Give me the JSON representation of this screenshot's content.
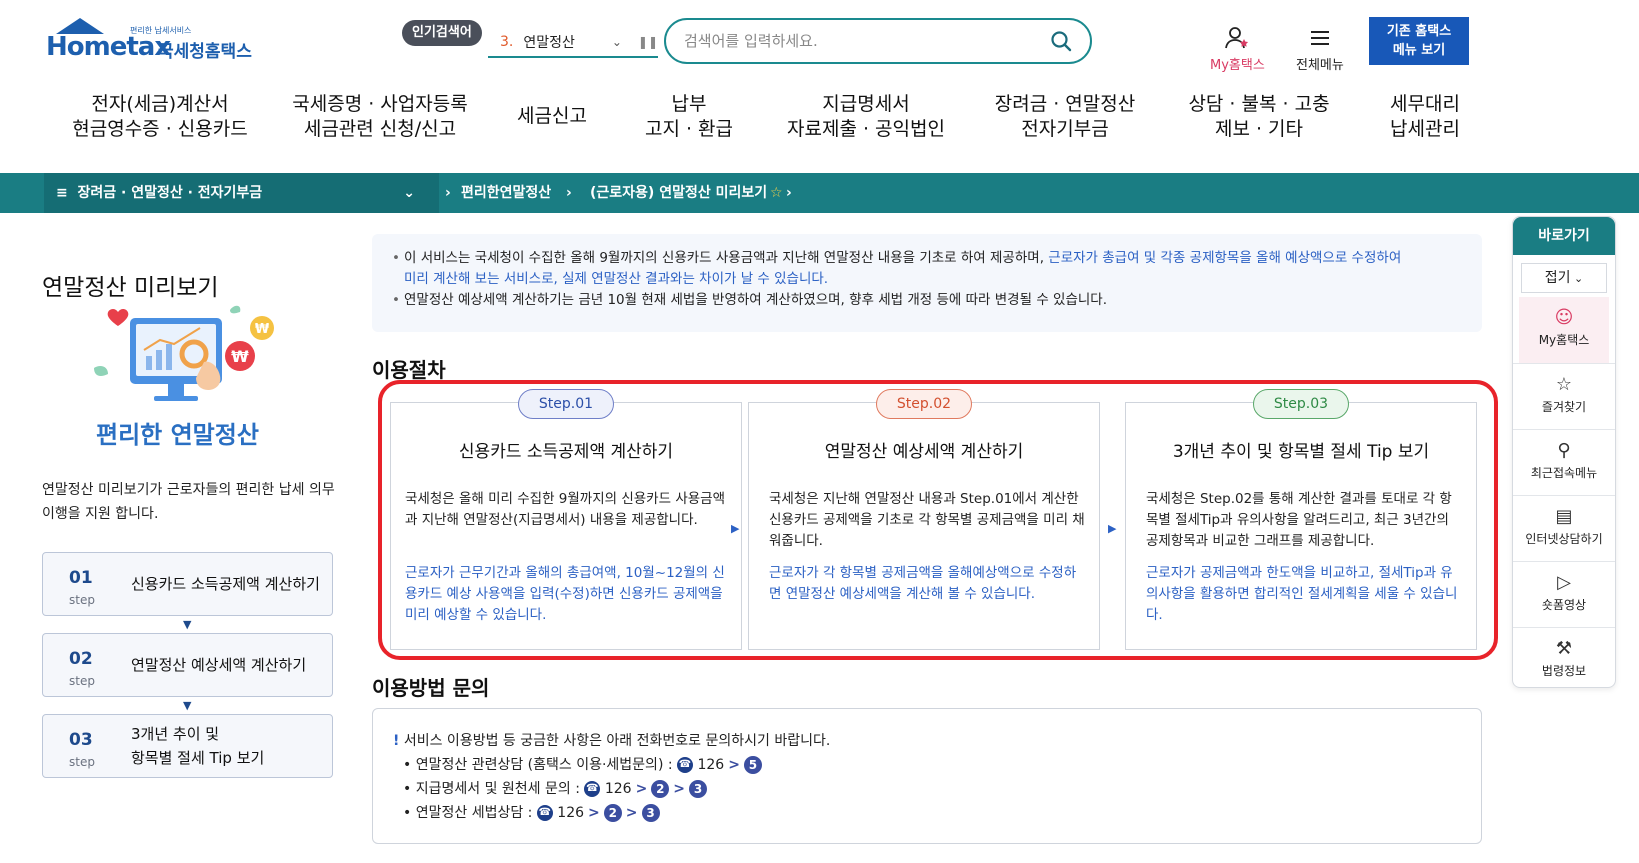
{
  "header": {
    "logo_small": "편리한 납세서비스",
    "logo_big": "Hometax",
    "logo_kor": "국세청홈택스",
    "popular_label": "인기검색어",
    "popular_num": "3.",
    "popular_term": "연말정산",
    "search_placeholder": "검색어를 입력하세요.",
    "my_hometax": "My홈택스",
    "all_menu": "전체메뉴",
    "legacy_line1": "기존 홈택스",
    "legacy_line2": "메뉴 보기"
  },
  "gnb": [
    {
      "l1": "전자(세금)계산서",
      "l2": "현금영수증 · 신용카드"
    },
    {
      "l1": "국세증명 · 사업자등록",
      "l2": "세금관련 신청/신고"
    },
    {
      "l1": "세금신고",
      "l2": ""
    },
    {
      "l1": "납부",
      "l2": "고지 · 환급"
    },
    {
      "l1": "지급명세서",
      "l2": "자료제출 · 공익법인"
    },
    {
      "l1": "장려금 · 연말정산",
      "l2": "전자기부금"
    },
    {
      "l1": "상담 · 불복 · 고충",
      "l2": "제보 · 기타"
    },
    {
      "l1": "세무대리",
      "l2": "납세관리"
    }
  ],
  "breadcrumb": {
    "c1": "장려금 · 연말정산 · 전자기부금",
    "c2": "편리한연말정산",
    "c3": "(근로자용) 연말정산 미리보기"
  },
  "left": {
    "title": "연말정산 미리보기",
    "brand": "편리한 연말정산",
    "desc": "연말정산 미리보기가 근로자들의  편리한 납세 의무 이행을 지원 합니다.",
    "steps": [
      {
        "n": "01",
        "s": "step",
        "t1": "신용카드 소득공제액 계산하기",
        "t2": ""
      },
      {
        "n": "02",
        "s": "step",
        "t1": "연말정산 예상세액 계산하기",
        "t2": ""
      },
      {
        "n": "03",
        "s": "step",
        "t1": "3개년 추이 및",
        "t2": "항목별 절세 Tip 보기"
      }
    ]
  },
  "notice": {
    "a1": "이 서비스는 국세청이 수집한 올해 9월까지의 신용카드 사용금액과 지난해 연말정산 내용을 기초로 하여 제공하며, ",
    "a2": "근로자가 총급여 및 각종 공제항목을 올해 예상액으로 수정하여",
    "a3": "미리 계산해 보는 서비스로, 실제 연말정산 결과와는 차이가 날 수 있습니다.",
    "b": "연말정산 예상세액 계산하기는 금년 10월 현재 세법을 반영하여 계산하였으며, 향후 세법 개정 등에 따라 변경될 수 있습니다."
  },
  "procedure": {
    "title": "이용절차",
    "cards": [
      {
        "badge": "Step.01",
        "title": "신용카드 소득공제액 계산하기",
        "body": "국세청은 올해 미리 수집한 9월까지의 신용카드 사용금액과 지난해 연말정산(지급명세서) 내용을 제공합니다.",
        "blue": "근로자가 근무기간과 올해의 총급여액, 10월~12월의 신용카드 예상 사용액을 입력(수정)하면 신용카드 공제액을 미리 예상할 수 있습니다."
      },
      {
        "badge": "Step.02",
        "title": "연말정산 예상세액 계산하기",
        "body": "국세청은 지난해 연말정산 내용과 Step.01에서 계산한 신용카드 공제액을 기초로 각 항목별 공제금액을 미리 채워줍니다.",
        "blue": "근로자가 각 항목별 공제금액을 올해예상액으로 수정하면 연말정산 예상세액을 계산해 볼 수 있습니다."
      },
      {
        "badge": "Step.03",
        "title": "3개년 추이 및 항목별 절세 Tip 보기",
        "body": "국세청은 Step.02를 통해 계산한 결과를 토대로 각 항목별 절세Tip과 유의사항을 알려드리고, 최근 3년간의 공제항목과 비교한 그래프를 제공합니다.",
        "blue": "근로자가 공제금액과 한도액을 비교하고, 절세Tip과 유의사항을 활용하면 합리적인 절세계획을 세울 수 있습니다."
      }
    ]
  },
  "inquiry": {
    "title": "이용방법 문의",
    "intro": "서비스 이용방법 등 궁금한 사항은 아래 전화번호로 문의하시기 바랍니다.",
    "lines": [
      {
        "label": "연말정산 관련상담 (홈택스 이용·세법문의) :",
        "num": "126",
        "opts": [
          "5"
        ]
      },
      {
        "label": "지급명세서 및 원천세 문의 :",
        "num": "126",
        "opts": [
          "2",
          "3"
        ]
      },
      {
        "label": "연말정산 세법상담 :",
        "num": "126",
        "opts": [
          "2",
          "3"
        ]
      }
    ]
  },
  "quick": {
    "head": "바로가기",
    "fold": "접기",
    "items": [
      "My홈택스",
      "즐겨찾기",
      "최근접속메뉴",
      "인터넷상담하기",
      "숏폼영상",
      "법령정보"
    ]
  }
}
